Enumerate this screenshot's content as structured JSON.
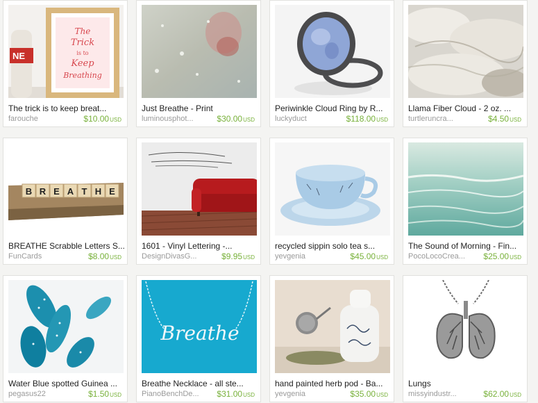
{
  "listings": [
    {
      "title": "The trick is to keep breat...",
      "shop": "farouche",
      "price": "$10.00",
      "currency": "USD",
      "image": "framed-print-and-bottle",
      "image_text": [
        "The",
        "Trick",
        "is to",
        "Keep",
        "Breathing"
      ],
      "label_text": "NE"
    },
    {
      "title": "Just Breathe - Print",
      "shop": "luminousphot...",
      "price": "$30.00",
      "currency": "USD",
      "image": "foggy-window-photo"
    },
    {
      "title": "Periwinkle Cloud Ring by R...",
      "shop": "luckyduct",
      "price": "$118.00",
      "currency": "USD",
      "image": "periwinkle-ring"
    },
    {
      "title": "Llama Fiber Cloud - 2 oz. ...",
      "shop": "turtleruncra...",
      "price": "$4.50",
      "currency": "USD",
      "image": "llama-fiber"
    },
    {
      "title": "BREATHE Scrabble Letters S...",
      "shop": "FunCards",
      "price": "$8.00",
      "currency": "USD",
      "image": "scrabble-tiles",
      "tile_letters": [
        "B",
        "R",
        "E",
        "A",
        "T",
        "H",
        "E"
      ]
    },
    {
      "title": "1601 - Vinyl Lettering -...",
      "shop": "DesignDivasG...",
      "price": "$9.95",
      "currency": "USD",
      "image": "red-sofa-wall-lettering"
    },
    {
      "title": "recycled sippin solo tea s...",
      "shop": "yevgenia",
      "price": "$45.00",
      "currency": "USD",
      "image": "teacup-and-saucer"
    },
    {
      "title": "The Sound of Morning - Fin...",
      "shop": "PocoLocoCrea...",
      "price": "$25.00",
      "currency": "USD",
      "image": "sea-photo"
    },
    {
      "title": "Water Blue spotted Guinea ...",
      "shop": "pegasus22",
      "price": "$1.50",
      "currency": "USD",
      "image": "blue-feathers"
    },
    {
      "title": "Breathe Necklace - all ste...",
      "shop": "PianoBenchDe...",
      "price": "$31.00",
      "currency": "USD",
      "image": "breathe-wire-necklace",
      "image_text": [
        "Breathe"
      ]
    },
    {
      "title": "hand painted herb pod - Ba...",
      "shop": "yevgenia",
      "price": "$35.00",
      "currency": "USD",
      "image": "herb-pod-and-tea-infuser"
    },
    {
      "title": "Lungs",
      "shop": "missyindustr...",
      "price": "$62.00",
      "currency": "USD",
      "image": "lungs-pendant"
    }
  ]
}
